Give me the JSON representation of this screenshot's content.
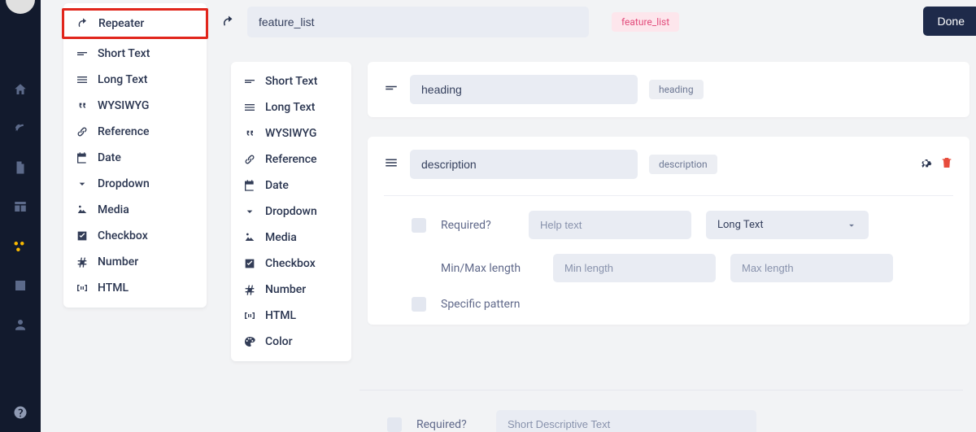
{
  "rail": {
    "items": [
      "home",
      "signal",
      "document",
      "table",
      "modules",
      "image",
      "users",
      "help"
    ]
  },
  "palette_primary": {
    "items": [
      {
        "label": "Repeater",
        "icon": "repeat",
        "highlight": true
      },
      {
        "label": "Short Text",
        "icon": "short"
      },
      {
        "label": "Long Text",
        "icon": "long"
      },
      {
        "label": "WYSIWYG",
        "icon": "quote"
      },
      {
        "label": "Reference",
        "icon": "link"
      },
      {
        "label": "Date",
        "icon": "date"
      },
      {
        "label": "Dropdown",
        "icon": "dropdown"
      },
      {
        "label": "Media",
        "icon": "media"
      },
      {
        "label": "Checkbox",
        "icon": "check"
      },
      {
        "label": "Number",
        "icon": "number"
      },
      {
        "label": "HTML",
        "icon": "html"
      }
    ]
  },
  "palette_secondary": {
    "items": [
      {
        "label": "Short Text",
        "icon": "short"
      },
      {
        "label": "Long Text",
        "icon": "long"
      },
      {
        "label": "WYSIWYG",
        "icon": "quote"
      },
      {
        "label": "Reference",
        "icon": "link"
      },
      {
        "label": "Date",
        "icon": "date"
      },
      {
        "label": "Dropdown",
        "icon": "dropdown"
      },
      {
        "label": "Media",
        "icon": "media"
      },
      {
        "label": "Checkbox",
        "icon": "check"
      },
      {
        "label": "Number",
        "icon": "number"
      },
      {
        "label": "HTML",
        "icon": "html"
      },
      {
        "label": "Color",
        "icon": "color"
      }
    ]
  },
  "header": {
    "name_value": "feature_list",
    "tag": "feature_list",
    "done_label": "Done"
  },
  "fields": {
    "heading": {
      "name": "heading",
      "slug": "heading"
    },
    "description": {
      "name": "description",
      "slug": "description",
      "required_label": "Required?",
      "help_placeholder": "Help text",
      "type_selected": "Long Text",
      "minmax_label": "Min/Max length",
      "min_placeholder": "Min length",
      "max_placeholder": "Max length",
      "pattern_label": "Specific pattern"
    }
  },
  "bottom": {
    "required_label": "Required?",
    "desc_placeholder": "Short Descriptive Text"
  }
}
